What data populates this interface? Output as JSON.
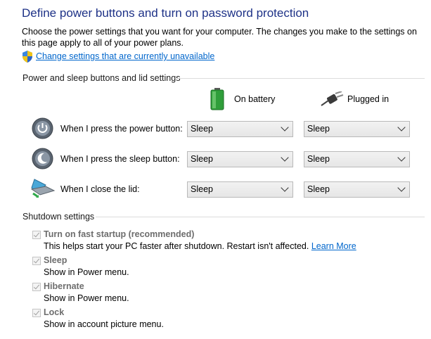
{
  "header": {
    "title": "Define power buttons and turn on password protection",
    "description": "Choose the power settings that you want for your computer. The changes you make to the settings on this page apply to all of your power plans.",
    "change_settings_link": "Change settings that are currently unavailable"
  },
  "power_section": {
    "title": "Power and sleep buttons and lid settings",
    "columns": {
      "battery": "On battery",
      "plugged": "Plugged in"
    },
    "rows": [
      {
        "label": "When I press the power button:",
        "battery": "Sleep",
        "plugged": "Sleep",
        "icon": "power-button-icon"
      },
      {
        "label": "When I press the sleep button:",
        "battery": "Sleep",
        "plugged": "Sleep",
        "icon": "sleep-button-icon"
      },
      {
        "label": "When I close the lid:",
        "battery": "Sleep",
        "plugged": "Sleep",
        "icon": "laptop-lid-icon"
      }
    ]
  },
  "shutdown_section": {
    "title": "Shutdown settings",
    "options": [
      {
        "title": "Turn on fast startup (recommended)",
        "desc": "This helps start your PC faster after shutdown. Restart isn't affected.",
        "link": "Learn More",
        "checked": true
      },
      {
        "title": "Sleep",
        "desc": "Show in Power menu.",
        "checked": true
      },
      {
        "title": "Hibernate",
        "desc": "Show in Power menu.",
        "checked": true
      },
      {
        "title": "Lock",
        "desc": "Show in account picture menu.",
        "checked": true
      }
    ]
  },
  "colors": {
    "title": "#1e3287",
    "link": "#0066cc",
    "disabled_text": "#6d6d6d"
  }
}
